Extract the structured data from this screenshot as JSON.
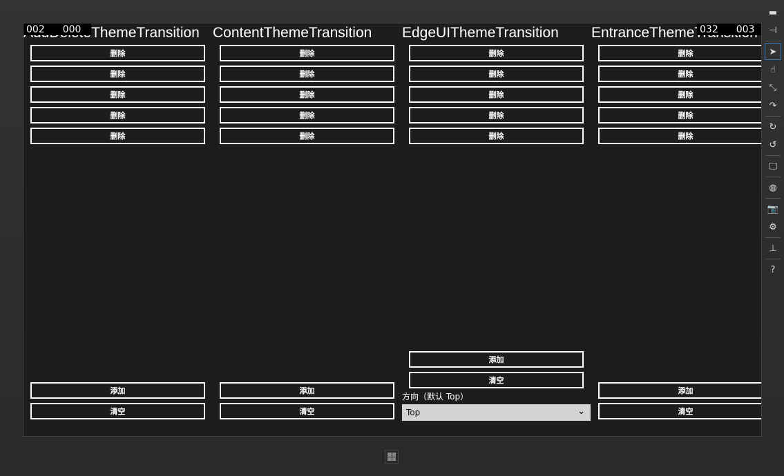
{
  "columns": [
    {
      "title": "AddDeleteThemeTransition",
      "items": [
        "删除",
        "删除",
        "删除",
        "删除",
        "删除"
      ],
      "add_label": "添加",
      "clear_label": "清空"
    },
    {
      "title": "ContentThemeTransition",
      "items": [
        "删除",
        "删除",
        "删除",
        "删除",
        "删除"
      ],
      "add_label": "添加",
      "clear_label": "清空"
    },
    {
      "title": "EdgeUIThemeTransition",
      "items": [
        "删除",
        "删除",
        "删除",
        "删除",
        "删除"
      ],
      "add_label": "添加",
      "clear_label": "清空",
      "direction_label": "方向（默认 Top）",
      "direction_value": "Top"
    },
    {
      "title": "EntranceThemeTransition",
      "items": [
        "删除",
        "删除",
        "删除",
        "删除",
        "删除"
      ],
      "add_label": "添加",
      "clear_label": "清空"
    }
  ],
  "frame_counters": {
    "left": [
      "002",
      "000"
    ],
    "right": [
      "032",
      "003"
    ]
  },
  "toolbar": {
    "icons": [
      "minimize-icon",
      "pin-icon",
      "pointer-icon",
      "touch-icon",
      "pinch-zoom-icon",
      "rotate-touch-icon",
      "rotate-clockwise-icon",
      "rotate-counterclockwise-icon",
      "resolution-icon",
      "location-icon",
      "screenshot-icon",
      "settings-icon",
      "network-icon",
      "help-icon"
    ],
    "selected": "pointer-icon"
  },
  "colors": {
    "app_bg": "#1d1d1d",
    "combo_bg": "#d4d4d4",
    "selected_border": "#3a7ab8"
  }
}
